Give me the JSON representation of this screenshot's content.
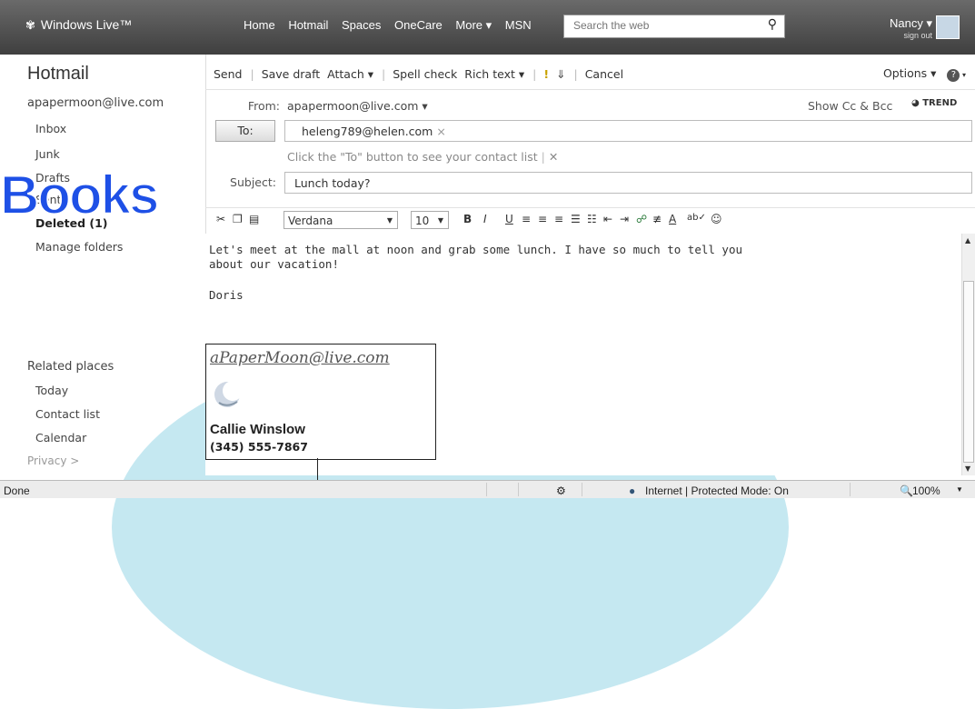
{
  "browser": {
    "brand": "Windows Live™"
  },
  "topnav": [
    "Home",
    "Hotmail",
    "Spaces",
    "OneCare",
    "More ▾",
    "MSN"
  ],
  "search": {
    "placeholder": "Search the web"
  },
  "user": {
    "name": "Nancy ▾",
    "sign_out": "sign out"
  },
  "sidebar": {
    "title": "Hotmail",
    "account": "apapermoon@live.com",
    "folders": [
      "Inbox",
      "Junk",
      "Drafts",
      "Sent",
      "Deleted (1)",
      "Manage folders"
    ],
    "related_heading": "Related places",
    "related": [
      "Today",
      "Contact list",
      "Calendar"
    ],
    "privacy": "Privacy >"
  },
  "toolbar": {
    "send": "Send",
    "save_draft": "Save draft",
    "attach": "Attach ▾",
    "spell_check": "Spell check",
    "rich_text": "Rich text ▾",
    "cancel": "Cancel",
    "options": "Options ▾"
  },
  "compose": {
    "from_label": "From:",
    "from_value": "apapermoon@live.com ▾",
    "show_cc": "Show Cc & Bcc",
    "trend": "TREND",
    "to_button": "To:",
    "to_recipient": "heleng789@helen.com",
    "to_hint": "Click the \"To\" button to see your contact list",
    "subject_label": "Subject:",
    "subject_value": "Lunch today?"
  },
  "format": {
    "font": "Verdana",
    "size": "10"
  },
  "message": {
    "line1": "Let's meet at the mall at noon and grab some lunch. I have so much to tell you",
    "line2": "about our vacation!",
    "line3": "Doris"
  },
  "signature": {
    "email": "aPaperMoon@live.com",
    "name": "Callie Winslow",
    "phone": "(345) 555-7867"
  },
  "overlay_text": "Books",
  "status": {
    "left": "Done",
    "zone": "Internet | Protected Mode: On",
    "zoom": "100%"
  }
}
